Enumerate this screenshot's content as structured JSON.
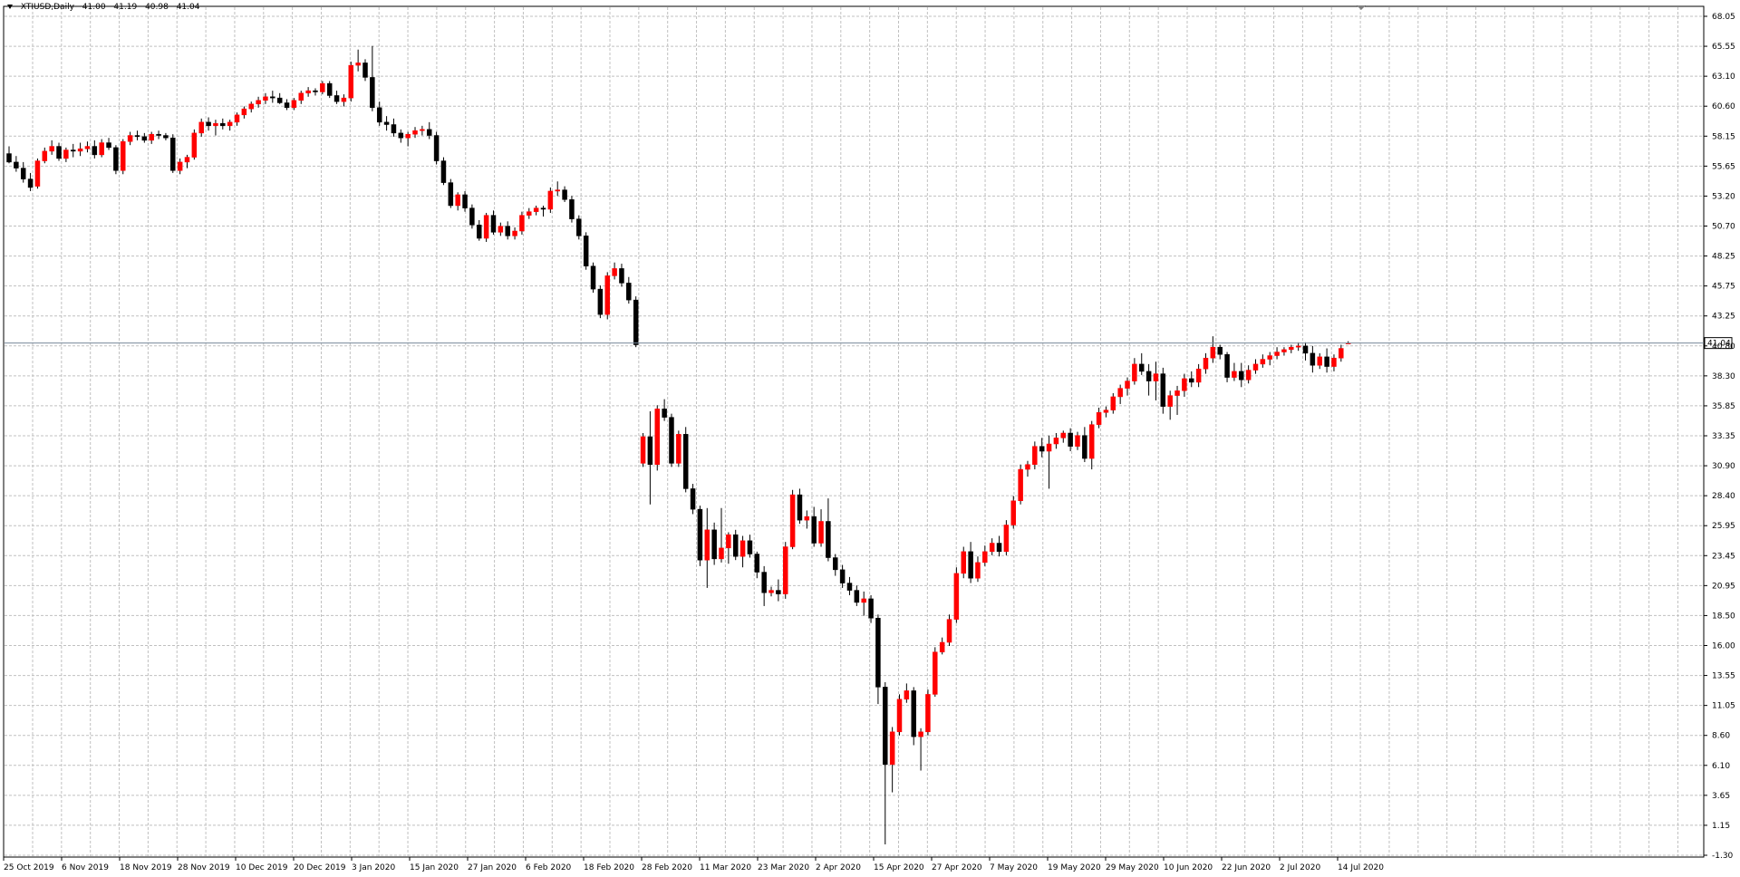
{
  "header": {
    "symbol": "XTIUSD,Daily",
    "open": "41.00",
    "high": "41.19",
    "low": "40.98",
    "close": "41.04"
  },
  "chart_data": {
    "type": "candlestick",
    "title": "",
    "ylim": [
      -1.3,
      68.05
    ],
    "y_ticks": [
      "68.05",
      "65.55",
      "63.10",
      "60.60",
      "58.15",
      "55.65",
      "53.20",
      "50.70",
      "48.25",
      "45.75",
      "43.25",
      "40.80",
      "38.30",
      "35.85",
      "33.35",
      "30.90",
      "28.40",
      "25.95",
      "23.45",
      "20.95",
      "18.50",
      "16.00",
      "13.55",
      "11.05",
      "8.60",
      "6.10",
      "3.65",
      "1.15",
      "-1.30"
    ],
    "x_ticks": [
      "25 Oct 2019",
      "6 Nov 2019",
      "18 Nov 2019",
      "28 Nov 2019",
      "10 Dec 2019",
      "20 Dec 2019",
      "3 Jan 2020",
      "15 Jan 2020",
      "27 Jan 2020",
      "6 Feb 2020",
      "18 Feb 2020",
      "28 Feb 2020",
      "11 Mar 2020",
      "23 Mar 2020",
      "2 Apr 2020",
      "15 Apr 2020",
      "27 Apr 2020",
      "7 May 2020",
      "19 May 2020",
      "29 May 2020",
      "10 Jun 2020",
      "22 Jun 2020",
      "2 Jul 2020",
      "14 Jul 2020"
    ],
    "current_price": "41.04",
    "grid": true,
    "colors": {
      "bull": "#ff0000",
      "bear": "#000000",
      "grid": "#c0c0c0",
      "price_line": "#778899"
    },
    "candles": [
      [
        56.7,
        57.3,
        55.9,
        56.0
      ],
      [
        56.0,
        56.5,
        55.2,
        55.5
      ],
      [
        55.5,
        56.0,
        54.3,
        54.6
      ],
      [
        54.6,
        55.1,
        53.6,
        53.9
      ],
      [
        54.0,
        56.3,
        53.8,
        56.1
      ],
      [
        56.1,
        57.2,
        55.9,
        56.9
      ],
      [
        56.9,
        57.8,
        56.6,
        57.3
      ],
      [
        57.3,
        57.6,
        56.1,
        56.3
      ],
      [
        56.3,
        57.2,
        56.0,
        57.0
      ],
      [
        57.0,
        57.5,
        56.4,
        56.9
      ],
      [
        56.9,
        57.6,
        56.5,
        57.1
      ],
      [
        57.1,
        57.7,
        56.8,
        57.3
      ],
      [
        57.3,
        57.8,
        56.3,
        56.6
      ],
      [
        56.6,
        57.9,
        56.4,
        57.6
      ],
      [
        57.6,
        58.0,
        57.0,
        57.2
      ],
      [
        57.2,
        57.4,
        55.0,
        55.3
      ],
      [
        55.3,
        57.9,
        55.0,
        57.7
      ],
      [
        57.7,
        58.5,
        57.4,
        58.2
      ],
      [
        58.2,
        58.6,
        57.8,
        58.1
      ],
      [
        58.1,
        58.4,
        57.6,
        57.8
      ],
      [
        57.8,
        58.5,
        57.5,
        58.3
      ],
      [
        58.3,
        58.6,
        57.9,
        58.2
      ],
      [
        58.2,
        58.4,
        57.8,
        58.0
      ],
      [
        58.0,
        58.3,
        55.1,
        55.3
      ],
      [
        55.3,
        56.3,
        55.0,
        56.0
      ],
      [
        56.0,
        56.6,
        55.5,
        56.4
      ],
      [
        56.4,
        58.7,
        56.2,
        58.4
      ],
      [
        58.4,
        59.6,
        58.1,
        59.3
      ],
      [
        59.3,
        59.7,
        58.6,
        59.0
      ],
      [
        59.0,
        59.5,
        58.2,
        59.2
      ],
      [
        59.2,
        59.6,
        58.7,
        59.0
      ],
      [
        59.0,
        59.5,
        58.6,
        59.3
      ],
      [
        59.3,
        60.1,
        59.0,
        59.9
      ],
      [
        59.9,
        60.6,
        59.6,
        60.4
      ],
      [
        60.4,
        61.0,
        60.1,
        60.8
      ],
      [
        60.8,
        61.4,
        60.5,
        61.1
      ],
      [
        61.1,
        61.7,
        60.8,
        61.4
      ],
      [
        61.4,
        61.9,
        60.9,
        61.3
      ],
      [
        61.3,
        61.7,
        60.8,
        60.9
      ],
      [
        60.9,
        61.2,
        60.3,
        60.5
      ],
      [
        60.5,
        61.3,
        60.3,
        61.1
      ],
      [
        61.1,
        61.9,
        60.8,
        61.7
      ],
      [
        61.7,
        62.2,
        61.4,
        61.9
      ],
      [
        61.9,
        62.1,
        61.5,
        61.8
      ],
      [
        61.8,
        62.7,
        61.6,
        62.5
      ],
      [
        62.5,
        62.7,
        61.3,
        61.5
      ],
      [
        61.5,
        61.9,
        60.8,
        61.0
      ],
      [
        61.0,
        61.6,
        60.6,
        61.3
      ],
      [
        61.3,
        64.3,
        61.0,
        64.0
      ],
      [
        64.0,
        65.3,
        63.5,
        64.2
      ],
      [
        64.2,
        64.5,
        62.7,
        63.0
      ],
      [
        63.0,
        65.6,
        60.2,
        60.5
      ],
      [
        60.5,
        61.0,
        59.0,
        59.3
      ],
      [
        59.3,
        59.8,
        58.6,
        59.1
      ],
      [
        59.1,
        59.6,
        58.1,
        58.4
      ],
      [
        58.4,
        58.7,
        57.6,
        58.0
      ],
      [
        58.0,
        58.5,
        57.3,
        58.3
      ],
      [
        58.3,
        58.9,
        58.0,
        58.6
      ],
      [
        58.6,
        59.0,
        58.2,
        58.7
      ],
      [
        58.7,
        59.3,
        57.9,
        58.2
      ],
      [
        58.2,
        58.5,
        55.8,
        56.1
      ],
      [
        56.1,
        56.4,
        54.1,
        54.3
      ],
      [
        54.3,
        54.6,
        52.2,
        52.4
      ],
      [
        52.4,
        53.5,
        52.0,
        53.3
      ],
      [
        53.3,
        53.6,
        51.9,
        52.2
      ],
      [
        52.2,
        52.5,
        50.5,
        50.8
      ],
      [
        50.8,
        51.2,
        49.5,
        49.7
      ],
      [
        49.7,
        51.8,
        49.4,
        51.6
      ],
      [
        51.6,
        52.0,
        50.0,
        50.2
      ],
      [
        50.2,
        51.0,
        49.9,
        50.7
      ],
      [
        50.7,
        51.1,
        49.6,
        49.9
      ],
      [
        49.9,
        50.6,
        49.6,
        50.3
      ],
      [
        50.3,
        51.9,
        50.0,
        51.6
      ],
      [
        51.6,
        52.2,
        51.3,
        51.9
      ],
      [
        51.9,
        52.4,
        51.6,
        52.2
      ],
      [
        52.2,
        52.4,
        51.5,
        52.1
      ],
      [
        52.1,
        53.9,
        51.8,
        53.6
      ],
      [
        53.6,
        54.4,
        53.2,
        53.7
      ],
      [
        53.7,
        54.0,
        52.7,
        52.9
      ],
      [
        52.9,
        53.2,
        51.0,
        51.3
      ],
      [
        51.3,
        51.6,
        49.6,
        49.9
      ],
      [
        49.9,
        50.2,
        47.1,
        47.4
      ],
      [
        47.4,
        47.7,
        45.2,
        45.5
      ],
      [
        45.5,
        45.8,
        43.1,
        43.4
      ],
      [
        43.4,
        46.9,
        43.0,
        46.6
      ],
      [
        46.6,
        47.7,
        46.3,
        47.2
      ],
      [
        47.2,
        47.6,
        45.7,
        46.0
      ],
      [
        46.0,
        46.5,
        44.3,
        44.6
      ],
      [
        44.6,
        44.9,
        40.7,
        40.9
      ],
      [
        31.1,
        33.6,
        30.8,
        33.3
      ],
      [
        33.3,
        35.4,
        27.7,
        31.0
      ],
      [
        31.0,
        35.9,
        30.5,
        35.6
      ],
      [
        35.6,
        36.4,
        34.6,
        34.9
      ],
      [
        34.9,
        35.2,
        30.8,
        31.1
      ],
      [
        31.1,
        33.8,
        30.8,
        33.5
      ],
      [
        33.5,
        34.1,
        28.7,
        29.0
      ],
      [
        29.0,
        29.4,
        26.9,
        27.3
      ],
      [
        27.3,
        27.6,
        22.6,
        23.1
      ],
      [
        23.1,
        27.4,
        20.8,
        25.6
      ],
      [
        25.6,
        26.2,
        22.7,
        23.2
      ],
      [
        23.2,
        27.4,
        22.9,
        24.1
      ],
      [
        24.1,
        25.4,
        22.8,
        25.2
      ],
      [
        25.2,
        25.6,
        23.1,
        23.4
      ],
      [
        23.4,
        25.1,
        22.5,
        24.7
      ],
      [
        24.7,
        25.2,
        23.3,
        23.6
      ],
      [
        23.6,
        23.8,
        21.6,
        22.1
      ],
      [
        22.1,
        22.6,
        19.3,
        20.4
      ],
      [
        20.4,
        20.9,
        20.1,
        20.6
      ],
      [
        20.6,
        21.5,
        19.7,
        20.3
      ],
      [
        20.3,
        24.6,
        19.9,
        24.2
      ],
      [
        24.2,
        28.9,
        24.0,
        28.5
      ],
      [
        28.5,
        29.0,
        26.1,
        26.4
      ],
      [
        26.4,
        27.2,
        25.7,
        26.7
      ],
      [
        26.7,
        27.5,
        24.2,
        24.5
      ],
      [
        24.5,
        27.3,
        24.2,
        26.3
      ],
      [
        26.3,
        28.2,
        23.0,
        23.3
      ],
      [
        23.3,
        23.6,
        21.8,
        22.3
      ],
      [
        22.3,
        22.7,
        20.8,
        21.2
      ],
      [
        21.2,
        21.7,
        20.2,
        20.6
      ],
      [
        20.6,
        21.0,
        19.3,
        19.6
      ],
      [
        19.6,
        20.5,
        18.5,
        19.9
      ],
      [
        19.9,
        20.2,
        17.9,
        18.3
      ],
      [
        18.3,
        18.6,
        11.2,
        12.6
      ],
      [
        12.6,
        13.0,
        -0.4,
        6.2
      ],
      [
        6.2,
        9.3,
        3.9,
        8.9
      ],
      [
        8.9,
        12.0,
        8.6,
        11.6
      ],
      [
        11.6,
        12.9,
        11.3,
        12.3
      ],
      [
        12.3,
        12.6,
        7.8,
        8.5
      ],
      [
        8.5,
        9.2,
        5.7,
        8.9
      ],
      [
        8.9,
        12.4,
        8.6,
        12.0
      ],
      [
        12.0,
        15.9,
        11.8,
        15.5
      ],
      [
        15.5,
        16.7,
        15.3,
        16.3
      ],
      [
        16.3,
        18.6,
        16.0,
        18.2
      ],
      [
        18.2,
        22.5,
        17.9,
        22.0
      ],
      [
        22.0,
        24.2,
        21.6,
        23.8
      ],
      [
        23.8,
        24.6,
        21.2,
        21.6
      ],
      [
        21.6,
        23.4,
        21.3,
        22.9
      ],
      [
        22.9,
        24.3,
        22.6,
        23.8
      ],
      [
        23.8,
        24.9,
        23.5,
        24.5
      ],
      [
        24.5,
        25.1,
        23.4,
        23.8
      ],
      [
        23.8,
        26.4,
        23.5,
        26.0
      ],
      [
        26.0,
        28.4,
        25.7,
        28.0
      ],
      [
        28.0,
        31.0,
        27.7,
        30.6
      ],
      [
        30.6,
        31.3,
        30.0,
        31.0
      ],
      [
        31.0,
        32.9,
        30.6,
        32.5
      ],
      [
        32.5,
        33.2,
        31.6,
        32.1
      ],
      [
        32.1,
        33.4,
        29.0,
        32.7
      ],
      [
        32.7,
        33.6,
        32.3,
        33.2
      ],
      [
        33.2,
        33.8,
        32.8,
        33.6
      ],
      [
        33.6,
        34.0,
        32.1,
        32.5
      ],
      [
        32.5,
        33.7,
        32.2,
        33.4
      ],
      [
        33.4,
        34.1,
        31.2,
        31.5
      ],
      [
        31.5,
        34.6,
        30.6,
        34.3
      ],
      [
        34.3,
        35.7,
        34.0,
        35.3
      ],
      [
        35.3,
        35.8,
        34.9,
        35.5
      ],
      [
        35.5,
        36.9,
        35.2,
        36.6
      ],
      [
        36.6,
        37.6,
        36.0,
        37.3
      ],
      [
        37.3,
        38.2,
        36.7,
        37.9
      ],
      [
        37.9,
        39.8,
        37.6,
        39.3
      ],
      [
        39.3,
        40.2,
        38.4,
        38.7
      ],
      [
        38.7,
        39.3,
        36.7,
        37.9
      ],
      [
        37.9,
        39.5,
        36.3,
        38.5
      ],
      [
        38.5,
        39.0,
        35.2,
        35.8
      ],
      [
        35.8,
        37.1,
        34.7,
        36.7
      ],
      [
        36.7,
        37.5,
        35.1,
        37.1
      ],
      [
        37.1,
        38.5,
        36.6,
        38.1
      ],
      [
        38.1,
        38.7,
        37.4,
        37.8
      ],
      [
        37.8,
        39.3,
        37.4,
        38.9
      ],
      [
        38.9,
        40.2,
        38.5,
        39.8
      ],
      [
        39.8,
        41.6,
        39.4,
        40.7
      ],
      [
        40.7,
        40.9,
        39.7,
        40.1
      ],
      [
        40.1,
        40.3,
        37.8,
        38.2
      ],
      [
        38.2,
        39.4,
        37.9,
        38.7
      ],
      [
        38.7,
        39.4,
        37.4,
        38.0
      ],
      [
        38.0,
        39.2,
        37.7,
        38.8
      ],
      [
        38.8,
        39.7,
        38.5,
        39.3
      ],
      [
        39.3,
        40.1,
        39.0,
        39.7
      ],
      [
        39.7,
        40.3,
        39.2,
        40.0
      ],
      [
        40.0,
        40.7,
        39.7,
        40.3
      ],
      [
        40.3,
        40.7,
        40.0,
        40.5
      ],
      [
        40.5,
        40.9,
        40.2,
        40.7
      ],
      [
        40.7,
        41.1,
        40.4,
        40.8
      ],
      [
        40.8,
        41.1,
        39.6,
        40.2
      ],
      [
        40.2,
        40.8,
        38.6,
        39.2
      ],
      [
        39.2,
        40.2,
        38.9,
        39.9
      ],
      [
        39.9,
        40.6,
        38.6,
        39.1
      ],
      [
        39.1,
        40.1,
        38.7,
        39.8
      ],
      [
        39.8,
        40.9,
        39.5,
        40.6
      ],
      [
        41.0,
        41.19,
        40.98,
        41.04
      ]
    ]
  }
}
